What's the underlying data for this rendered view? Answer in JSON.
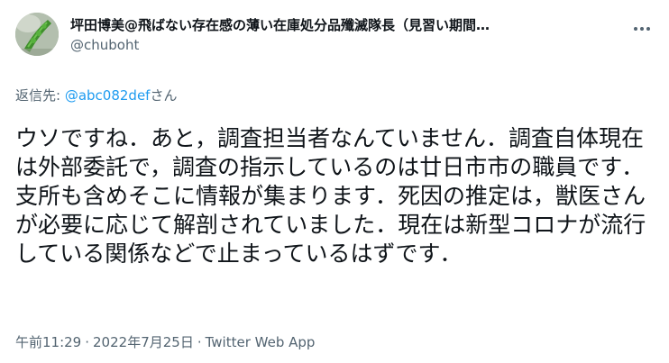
{
  "user": {
    "display_name": "坪田博美@飛ばない存在感の薄い在庫処分品殲滅隊長（見習い期間…",
    "handle": "@chuboht",
    "avatar_icon": "green-pod-avatar"
  },
  "reply": {
    "prefix": "返信先: ",
    "mention": "@abc082def",
    "suffix": "さん"
  },
  "tweet": {
    "text": "ウソですね．あと，調査担当者なんていません．調査自体現在は外部委託で，調査の指示しているのは廿日市市の職員です．支所も含めそこに情報が集まります．死因の推定は，獣医さんが必要に応じて解剖されていました．現在は新型コロナが流行している関係などで止まっているはずです．"
  },
  "meta": {
    "time": "午前11:29",
    "separator": "·",
    "date": "2022年7月25日",
    "source": "Twitter Web App"
  },
  "icons": {
    "more": "more-dots-icon"
  },
  "colors": {
    "text": "#0f1419",
    "secondary": "#536471",
    "link": "#1d9bf0"
  }
}
